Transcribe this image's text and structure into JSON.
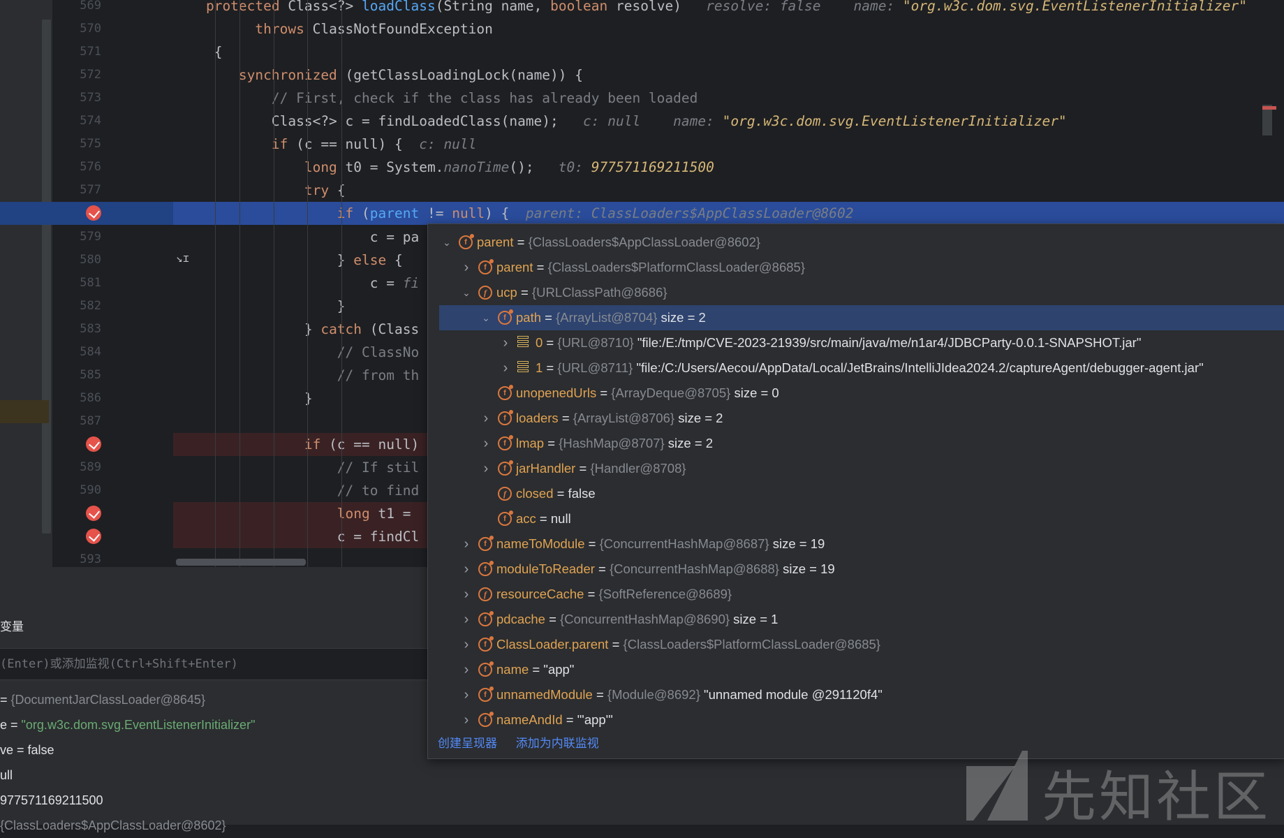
{
  "editor": {
    "lines": [
      {
        "num": "569",
        "indent": 0,
        "tokens": [
          [
            "kw",
            "    protected "
          ],
          [
            "",
            "Class<?> "
          ],
          [
            "fn",
            "loadClass"
          ],
          [
            "",
            "(String name, "
          ],
          [
            "kw",
            "boolean "
          ],
          [
            "",
            "resolve)  "
          ],
          [
            "hint",
            " resolve: false    name: "
          ],
          [
            "hintv",
            "\"org.w3c.dom.svg.EventListenerInitializer\""
          ]
        ]
      },
      {
        "num": "570",
        "tokens": [
          [
            "kw",
            "          throws "
          ],
          [
            "",
            "ClassNotFoundException"
          ]
        ]
      },
      {
        "num": "571",
        "tokens": [
          [
            "",
            "     {"
          ]
        ]
      },
      {
        "num": "572",
        "tokens": [
          [
            "kw",
            "        synchronized "
          ],
          [
            "",
            "(getClassLoadingLock(name)) {"
          ]
        ]
      },
      {
        "num": "573",
        "tokens": [
          [
            "cm",
            "            // First, check if the class has already been loaded"
          ]
        ]
      },
      {
        "num": "574",
        "tokens": [
          [
            "",
            "            Class<?> c = findLoadedClass(name);  "
          ],
          [
            "hint",
            " c: null    name: "
          ],
          [
            "hintv",
            "\"org.w3c.dom.svg.EventListenerInitializer\""
          ]
        ]
      },
      {
        "num": "575",
        "tokens": [
          [
            "kw",
            "            if "
          ],
          [
            "",
            "(c == null) {  "
          ],
          [
            "hint",
            "c: null"
          ]
        ]
      },
      {
        "num": "576",
        "tokens": [
          [
            "kw",
            "                long "
          ],
          [
            "",
            "t0 = System."
          ],
          [
            "hint",
            "nanoTime"
          ],
          [
            "",
            "();  "
          ],
          [
            "hint",
            " t0: "
          ],
          [
            "hintv",
            "977571169211500"
          ]
        ]
      },
      {
        "num": "577",
        "tokens": [
          [
            "kw",
            "                try "
          ],
          [
            "",
            "{"
          ]
        ]
      },
      {
        "num": "",
        "tokens": [
          [
            "kw",
            "                    if "
          ],
          [
            "",
            "("
          ],
          [
            "fn",
            "parent"
          ],
          [
            "",
            " != "
          ],
          [
            "kw",
            "null"
          ],
          [
            "",
            ") {  "
          ],
          [
            "hint",
            "parent: ClassLoaders$AppClassLoader@8602"
          ]
        ]
      },
      {
        "num": "579",
        "tokens": [
          [
            "",
            "                        c = pa"
          ]
        ]
      },
      {
        "num": "580",
        "tokens": [
          [
            "",
            "                    } "
          ],
          [
            "kw",
            "else "
          ],
          [
            "",
            "{"
          ]
        ]
      },
      {
        "num": "581",
        "tokens": [
          [
            "",
            "                        c = "
          ],
          [
            "hint",
            "fi"
          ]
        ]
      },
      {
        "num": "582",
        "tokens": [
          [
            "",
            "                    }"
          ]
        ]
      },
      {
        "num": "583",
        "tokens": [
          [
            "",
            "                } "
          ],
          [
            "kw",
            "catch "
          ],
          [
            "",
            "(Class"
          ]
        ]
      },
      {
        "num": "584",
        "tokens": [
          [
            "cm",
            "                    // ClassNo"
          ]
        ]
      },
      {
        "num": "585",
        "tokens": [
          [
            "cm",
            "                    // from th"
          ]
        ]
      },
      {
        "num": "586",
        "tokens": [
          [
            "",
            "                }"
          ]
        ]
      },
      {
        "num": "587",
        "tokens": [
          [
            "",
            ""
          ]
        ]
      },
      {
        "num": "",
        "tokens": [
          [
            "kw",
            "                if "
          ],
          [
            "",
            "(c == null)"
          ]
        ]
      },
      {
        "num": "589",
        "tokens": [
          [
            "cm",
            "                    // If stil"
          ]
        ]
      },
      {
        "num": "590",
        "tokens": [
          [
            "cm",
            "                    // to find"
          ]
        ]
      },
      {
        "num": "",
        "tokens": [
          [
            "kw",
            "                    long "
          ],
          [
            "",
            "t1 = "
          ]
        ]
      },
      {
        "num": "",
        "tokens": [
          [
            "",
            "                    c = findCl"
          ]
        ]
      },
      {
        "num": "593",
        "tokens": [
          [
            "",
            ""
          ]
        ]
      }
    ],
    "cursor_glyph": "↘ɪ"
  },
  "bottom": {
    "vars_tab": "变量",
    "eval_placeholder": "(Enter)或添加监视(Ctrl+Shift+Enter)",
    "vars": [
      {
        "pre": "= ",
        "gray": "{DocumentJarClassLoader@8645}",
        "rest": ""
      },
      {
        "pre": "e = ",
        "green": "\"org.w3c.dom.svg.EventListenerInitializer\""
      },
      {
        "pre": "ve = false"
      },
      {
        "pre": "ull"
      },
      {
        "pre": "977571169211500"
      },
      {
        "pre": "",
        "gray": "{ClassLoaders$AppClassLoader@8602}"
      }
    ]
  },
  "popup": {
    "rows": [
      {
        "chev": "v",
        "icon": "obj",
        "name": "parent",
        "eq": " = ",
        "type": "{ClassLoaders$AppClassLoader@8602}",
        "extra": ""
      },
      {
        "chev": ">",
        "icon": "obj",
        "name": "parent",
        "eq": " = ",
        "type": "{ClassLoaders$PlatformClassLoader@8685}",
        "extra": ""
      },
      {
        "chev": "v",
        "icon": "fld",
        "name": "ucp",
        "eq": " = ",
        "type": "{URLClassPath@8686}",
        "extra": ""
      },
      {
        "chev": "v",
        "icon": "obj",
        "name": "path",
        "eq": " = ",
        "type": "{ArrayList@8704}",
        "extra": "  size = 2"
      },
      {
        "chev": ">",
        "icon": "arr",
        "name": "0",
        "eq": " = ",
        "type": "{URL@8710}",
        "extra": " \"file:/E:/tmp/CVE-2023-21939/src/main/java/me/n1ar4/JDBCParty-0.0.1-SNAPSHOT.jar\""
      },
      {
        "chev": ">",
        "icon": "arr",
        "name": "1",
        "eq": " = ",
        "type": "{URL@8711}",
        "extra": " \"file:/C:/Users/Aecou/AppData/Local/JetBrains/IntelliJIdea2024.2/captureAgent/debugger-agent.jar\""
      },
      {
        "chev": "",
        "icon": "obj",
        "name": "unopenedUrls",
        "eq": " = ",
        "type": "{ArrayDeque@8705}",
        "extra": "  size = 0"
      },
      {
        "chev": ">",
        "icon": "obj",
        "name": "loaders",
        "eq": " = ",
        "type": "{ArrayList@8706}",
        "extra": "  size = 2"
      },
      {
        "chev": ">",
        "icon": "obj",
        "name": "lmap",
        "eq": " = ",
        "type": "{HashMap@8707}",
        "extra": "  size = 2"
      },
      {
        "chev": ">",
        "icon": "obj",
        "name": "jarHandler",
        "eq": " = ",
        "type": "{Handler@8708}",
        "extra": ""
      },
      {
        "chev": "",
        "icon": "fld",
        "name": "closed",
        "eq": " = ",
        "type": "",
        "extra": "false"
      },
      {
        "chev": "",
        "icon": "obj",
        "name": "acc",
        "eq": " = ",
        "type": "",
        "extra": "null"
      },
      {
        "chev": ">",
        "icon": "obj",
        "name": "nameToModule",
        "eq": " = ",
        "type": "{ConcurrentHashMap@8687}",
        "extra": "  size = 19"
      },
      {
        "chev": ">",
        "icon": "obj",
        "name": "moduleToReader",
        "eq": " = ",
        "type": "{ConcurrentHashMap@8688}",
        "extra": "  size = 19"
      },
      {
        "chev": ">",
        "icon": "fld",
        "name": "resourceCache",
        "eq": " = ",
        "type": "{SoftReference@8689}",
        "extra": ""
      },
      {
        "chev": ">",
        "icon": "obj",
        "name": "pdcache",
        "eq": " = ",
        "type": "{ConcurrentHashMap@8690}",
        "extra": "  size = 1"
      },
      {
        "chev": ">",
        "icon": "obj",
        "name": "ClassLoader.parent",
        "eq": " = ",
        "type": "{ClassLoaders$PlatformClassLoader@8685}",
        "extra": ""
      },
      {
        "chev": ">",
        "icon": "obj",
        "name": "name",
        "eq": " = ",
        "type": "",
        "extra": "\"app\""
      },
      {
        "chev": ">",
        "icon": "obj",
        "name": "unnamedModule",
        "eq": " = ",
        "type": "{Module@8692}",
        "extra": " \"unnamed module @291120f4\""
      },
      {
        "chev": ">",
        "icon": "obj",
        "name": "nameAndId",
        "eq": " = ",
        "type": "",
        "extra": "\"'app'\""
      }
    ],
    "footer": {
      "create_renderer": "创建呈现器",
      "add_inline_watch": "添加为内联监视"
    }
  },
  "watermark": {
    "text": "先知社区"
  }
}
